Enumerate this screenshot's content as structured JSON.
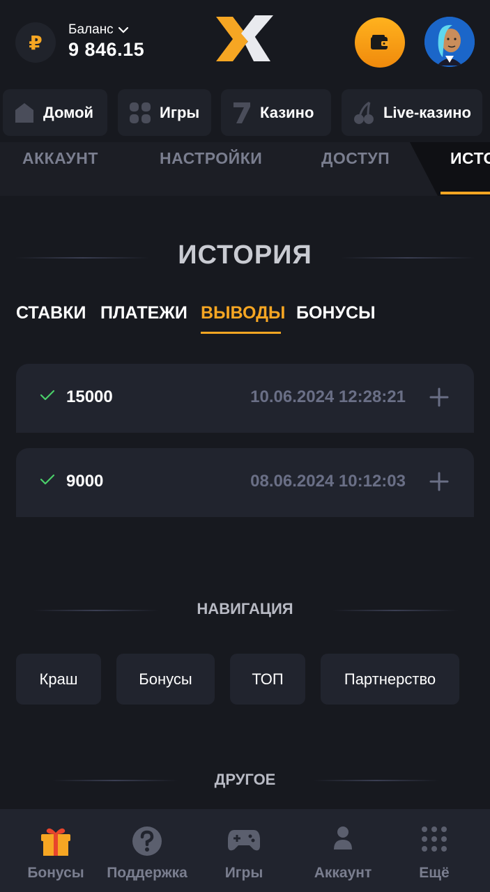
{
  "header": {
    "currency_symbol": "₽",
    "balance_label": "Баланс",
    "balance_value": "9 846.15"
  },
  "top_nav": [
    {
      "label": "Домой",
      "icon": "home-icon"
    },
    {
      "label": "Игры",
      "icon": "grid-icon"
    },
    {
      "label": "Казино",
      "icon": "seven-icon"
    },
    {
      "label": "Live-казино",
      "icon": "cherry-icon"
    }
  ],
  "account_tabs": [
    {
      "label": "АККАУНТ"
    },
    {
      "label": "НАСТРОЙКИ"
    },
    {
      "label": "ДОСТУП"
    },
    {
      "label": "ИСТОРИЯ",
      "active": true
    }
  ],
  "history": {
    "title": "ИСТОРИЯ",
    "tabs": [
      {
        "label": "СТАВКИ"
      },
      {
        "label": "ПЛАТЕЖИ"
      },
      {
        "label": "ВЫВОДЫ",
        "active": true
      },
      {
        "label": "БОНУСЫ"
      }
    ],
    "rows": [
      {
        "amount": "15000",
        "date": "10.06.2024 12:28:21",
        "status": "success"
      },
      {
        "amount": "9000",
        "date": "08.06.2024 10:12:03",
        "status": "success"
      }
    ]
  },
  "navigation": {
    "title": "НАВИГАЦИЯ",
    "links": [
      {
        "label": "Краш"
      },
      {
        "label": "Бонусы"
      },
      {
        "label": "ТОП"
      },
      {
        "label": "Партнерство"
      }
    ]
  },
  "other": {
    "title": "ДРУГОЕ"
  },
  "bottom_bar": [
    {
      "label": "Бонусы",
      "icon": "gift-icon"
    },
    {
      "label": "Поддержка",
      "icon": "help-icon"
    },
    {
      "label": "Игры",
      "icon": "gamepad-icon"
    },
    {
      "label": "Аккаунт",
      "icon": "user-icon"
    },
    {
      "label": "Ещё",
      "icon": "dots-grid-icon"
    }
  ],
  "colors": {
    "accent": "#f6a623",
    "background": "#17191f",
    "card": "#21242e",
    "muted_text": "#7a7e8f",
    "success": "#4ad06a"
  }
}
